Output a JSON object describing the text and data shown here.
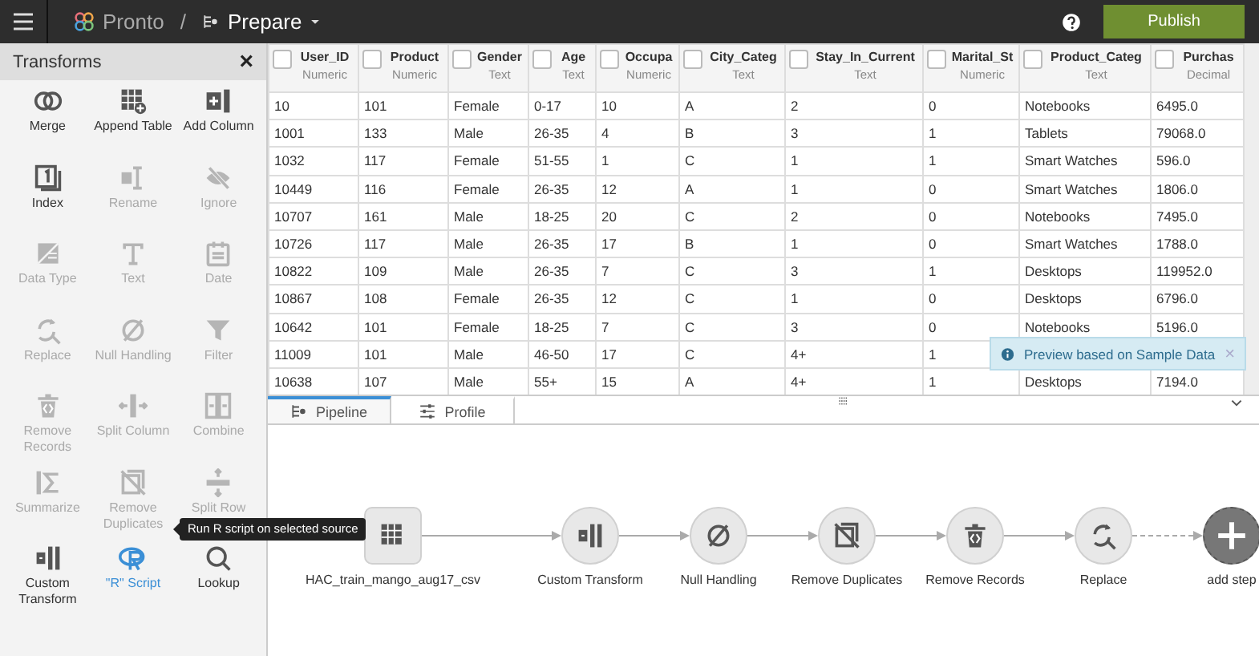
{
  "app": {
    "name": "Pronto",
    "separator": "/",
    "section": "Prepare",
    "publish": "Publish"
  },
  "sidebar": {
    "title": "Transforms",
    "close": "×",
    "tools": [
      {
        "label": "Merge",
        "kind": "merge",
        "disabled": false,
        "selected": false
      },
      {
        "label": "Append Table",
        "kind": "append",
        "disabled": false,
        "selected": false
      },
      {
        "label": "Add Column",
        "kind": "addcol",
        "disabled": false,
        "selected": false
      },
      {
        "label": "Index",
        "kind": "index",
        "disabled": false,
        "selected": false
      },
      {
        "label": "Rename",
        "kind": "rename",
        "disabled": true,
        "selected": false
      },
      {
        "label": "Ignore",
        "kind": "ignore",
        "disabled": true,
        "selected": false
      },
      {
        "label": "Data Type",
        "kind": "datatype",
        "disabled": true,
        "selected": false
      },
      {
        "label": "Text",
        "kind": "text",
        "disabled": true,
        "selected": false
      },
      {
        "label": "Date",
        "kind": "date",
        "disabled": true,
        "selected": false
      },
      {
        "label": "Replace",
        "kind": "replace",
        "disabled": true,
        "selected": false
      },
      {
        "label": "Null Handling",
        "kind": "null",
        "disabled": true,
        "selected": false
      },
      {
        "label": "Filter",
        "kind": "filter",
        "disabled": true,
        "selected": false
      },
      {
        "label": "Remove Records",
        "kind": "records",
        "disabled": true,
        "selected": false
      },
      {
        "label": "Split Column",
        "kind": "split",
        "disabled": true,
        "selected": false
      },
      {
        "label": "Combine",
        "kind": "combine",
        "disabled": true,
        "selected": false
      },
      {
        "label": "Summarize",
        "kind": "sum",
        "disabled": true,
        "selected": false
      },
      {
        "label": "Remove Duplicates",
        "kind": "dupes",
        "disabled": true,
        "selected": false
      },
      {
        "label": "Split Row",
        "kind": "splitrow",
        "disabled": true,
        "selected": false
      },
      {
        "label": "Custom Transform",
        "kind": "custom",
        "disabled": false,
        "selected": false
      },
      {
        "label": "\"R\" Script",
        "kind": "rscript",
        "disabled": false,
        "selected": true
      },
      {
        "label": "Lookup",
        "kind": "lookup",
        "disabled": false,
        "selected": false
      }
    ],
    "tooltip": "Run R script on selected source"
  },
  "table": {
    "columns": [
      {
        "name": "User_ID",
        "type": "Numeric",
        "checked": false
      },
      {
        "name": "Product",
        "type": "Numeric",
        "checked": false
      },
      {
        "name": "Gender",
        "type": "Text",
        "checked": false
      },
      {
        "name": "Age",
        "type": "Text",
        "checked": false
      },
      {
        "name": "Occupa",
        "type": "Numeric",
        "checked": false
      },
      {
        "name": "City_Categ",
        "type": "Text",
        "checked": false
      },
      {
        "name": "Stay_In_Current",
        "type": "Text",
        "checked": false
      },
      {
        "name": "Marital_St",
        "type": "Numeric",
        "checked": false
      },
      {
        "name": "Product_Categ",
        "type": "Text",
        "checked": false
      },
      {
        "name": "Purchas",
        "type": "Decimal",
        "checked": false
      }
    ],
    "rows": [
      [
        "10",
        "101",
        "Female",
        "0-17",
        "10",
        "A",
        "2",
        "0",
        "Notebooks",
        "6495.0"
      ],
      [
        "1001",
        "133",
        "Male",
        "26-35",
        "4",
        "B",
        "3",
        "1",
        "Tablets",
        "79068.0"
      ],
      [
        "1032",
        "117",
        "Female",
        "51-55",
        "1",
        "C",
        "1",
        "1",
        "Smart Watches",
        "596.0"
      ],
      [
        "10449",
        "116",
        "Female",
        "26-35",
        "12",
        "A",
        "1",
        "0",
        "Smart Watches",
        "1806.0"
      ],
      [
        "10707",
        "161",
        "Male",
        "18-25",
        "20",
        "C",
        "2",
        "0",
        "Notebooks",
        "7495.0"
      ],
      [
        "10726",
        "117",
        "Male",
        "26-35",
        "17",
        "B",
        "1",
        "0",
        "Smart Watches",
        "1788.0"
      ],
      [
        "10822",
        "109",
        "Male",
        "26-35",
        "7",
        "C",
        "3",
        "1",
        "Desktops",
        "119952.0"
      ],
      [
        "10867",
        "108",
        "Female",
        "26-35",
        "12",
        "C",
        "1",
        "0",
        "Desktops",
        "6796.0"
      ],
      [
        "10642",
        "101",
        "Female",
        "18-25",
        "7",
        "C",
        "3",
        "0",
        "Notebooks",
        "5196.0"
      ],
      [
        "11009",
        "101",
        "Male",
        "46-50",
        "17",
        "C",
        "4+",
        "1"
      ],
      [
        "10638",
        "107",
        "Male",
        "55+",
        "15",
        "A",
        "4+",
        "1",
        "Desktops",
        "7194.0"
      ]
    ],
    "toast": {
      "text": "Preview based on Sample Data",
      "close": "×"
    }
  },
  "panel": {
    "tabs": [
      {
        "label": "Pipeline",
        "kind": "pipeline",
        "selected": true
      },
      {
        "label": "Profile",
        "kind": "profile",
        "selected": false
      }
    ]
  },
  "pipeline": {
    "nodes": [
      {
        "label": "HAC_train_mango_aug17_csv",
        "kind": "source"
      },
      {
        "label": "Custom Transform",
        "kind": "custom"
      },
      {
        "label": "Null Handling",
        "kind": "null"
      },
      {
        "label": "Remove Duplicates",
        "kind": "dupes"
      },
      {
        "label": "Remove Records",
        "kind": "records"
      },
      {
        "label": "Replace",
        "kind": "replace"
      },
      {
        "label": "add step",
        "kind": "add"
      }
    ]
  }
}
